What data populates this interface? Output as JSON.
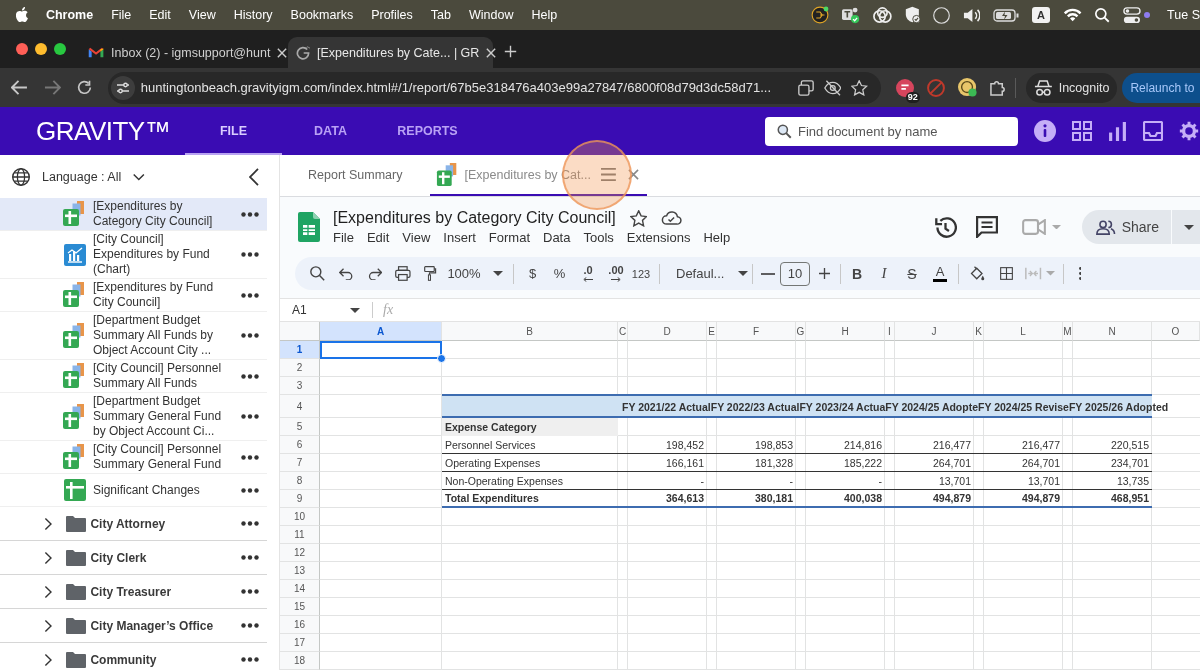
{
  "menubar": {
    "app": "Chrome",
    "items": [
      "File",
      "Edit",
      "View",
      "History",
      "Bookmarks",
      "Profiles",
      "Tab",
      "Window",
      "Help"
    ],
    "input_source": "A",
    "clock": "Tue S"
  },
  "browser": {
    "tabs": [
      {
        "kind": "mail",
        "title": "Inbox (2) - igmsupport@hunt",
        "selected": false
      },
      {
        "kind": "site",
        "title": "[Expenditures by Cate... | GR",
        "selected": true
      }
    ],
    "url": "huntingtonbeach.gravityigm.com/index.html#/1/report/67b5e318476a403e99a27847/6800f08d79d3dc58d71...",
    "extension_badge": "92",
    "profile": "Incognito",
    "relaunch": "Relaunch to"
  },
  "app_header": {
    "logo": "GRAVITY™",
    "tabs": [
      {
        "label": "FILE",
        "selected": true
      },
      {
        "label": "DATA",
        "selected": false
      },
      {
        "label": "REPORTS",
        "selected": false
      }
    ],
    "search": {
      "placeholder": "Find document by name"
    }
  },
  "sidebar": {
    "language": "Language : All",
    "items": [
      {
        "kind": "stack",
        "label": "[Expenditures by Category City Council]",
        "selected": true
      },
      {
        "kind": "chart",
        "label": "[City Council] Expenditures by Fund (Chart)",
        "selected": false
      },
      {
        "kind": "stack",
        "label": "[Expenditures by Fund City Council]",
        "selected": false
      },
      {
        "kind": "stack",
        "label": "[Department Budget Summary All Funds by Object Account City ...",
        "selected": false
      },
      {
        "kind": "stack",
        "label": "[City Council] Personnel Summary All Funds",
        "selected": false
      },
      {
        "kind": "stack",
        "label": "[Department Budget Summary General Fund by Object Account Ci...",
        "selected": false
      },
      {
        "kind": "stack",
        "label": "[City Council] Personnel Summary General Fund",
        "selected": false
      },
      {
        "kind": "sheet",
        "label": "Significant Changes",
        "selected": false
      },
      {
        "kind": "folder",
        "label": "City Attorney",
        "expanded": false,
        "selected": false
      },
      {
        "kind": "folder",
        "label": "City Clerk",
        "expanded": false,
        "selected": false
      },
      {
        "kind": "folder",
        "label": "City Treasurer",
        "expanded": false,
        "selected": false
      },
      {
        "kind": "folder",
        "label": "City Manager’s Office",
        "expanded": false,
        "selected": false
      },
      {
        "kind": "folder",
        "label": "Community",
        "expanded": false,
        "selected": false
      }
    ]
  },
  "report_tabs": [
    {
      "kind": "summary",
      "label": "Report Summary",
      "selected": false
    },
    {
      "kind": "sheet",
      "label": "[Expenditures by Cat...",
      "selected": true
    }
  ],
  "sheet": {
    "title": "[Expenditures by Category City Council]",
    "menu": [
      "File",
      "Edit",
      "View",
      "Insert",
      "Format",
      "Data",
      "Tools",
      "Extensions",
      "Help"
    ],
    "share": "Share",
    "toolbar": {
      "zoom": "100%",
      "currency": "$",
      "percent": "%",
      "decrease_decimal": ".0",
      "increase_decimal": ".00",
      "number_format": "123",
      "font": "Defaul...",
      "font_size": "10",
      "bold": "B",
      "italic": "I",
      "strikethrough": "S",
      "text_color": "A"
    },
    "name_box": "A1",
    "formula_icon": "fx",
    "columns": [
      {
        "label": "A",
        "selected": true
      },
      {
        "label": "B",
        "selected": false
      },
      {
        "label": "C",
        "selected": false
      },
      {
        "label": "D",
        "selected": false
      },
      {
        "label": "E",
        "selected": false
      },
      {
        "label": "F",
        "selected": false
      },
      {
        "label": "G",
        "selected": false
      },
      {
        "label": "H",
        "selected": false
      },
      {
        "label": "I",
        "selected": false
      },
      {
        "label": "J",
        "selected": false
      },
      {
        "label": "K",
        "selected": false
      },
      {
        "label": "L",
        "selected": false
      },
      {
        "label": "M",
        "selected": false
      },
      {
        "label": "N",
        "selected": false
      },
      {
        "label": "O",
        "selected": false
      }
    ],
    "rows": [
      {
        "label": "1",
        "selected": true
      },
      {
        "label": "2",
        "selected": false
      },
      {
        "label": "3",
        "selected": false
      },
      {
        "label": "4",
        "selected": false
      },
      {
        "label": "5",
        "selected": false
      },
      {
        "label": "6",
        "selected": false
      },
      {
        "label": "7",
        "selected": false
      },
      {
        "label": "8",
        "selected": false
      },
      {
        "label": "9",
        "selected": false
      },
      {
        "label": "10",
        "selected": false
      },
      {
        "label": "11",
        "selected": false
      },
      {
        "label": "12",
        "selected": false
      },
      {
        "label": "13",
        "selected": false
      },
      {
        "label": "14",
        "selected": false
      },
      {
        "label": "15",
        "selected": false
      },
      {
        "label": "16",
        "selected": false
      },
      {
        "label": "17",
        "selected": false
      },
      {
        "label": "18",
        "selected": false
      }
    ],
    "table": {
      "headings": [
        "FY 2021/22 Actual",
        "FY 2022/23 Actual",
        "FY 2023/24 Actua",
        "FY 2024/25 Adopte",
        "FY 2024/25 Revise",
        "FY 2025/26 Adopted"
      ],
      "category_label": "Expense Category",
      "rows": [
        {
          "label": "Personnel Services",
          "total": false,
          "values": [
            "198,452",
            "198,853",
            "214,816",
            "216,477",
            "216,477",
            "220,515"
          ]
        },
        {
          "label": "Operating Expenses",
          "total": false,
          "values": [
            "166,161",
            "181,328",
            "185,222",
            "264,701",
            "264,701",
            "234,701"
          ]
        },
        {
          "label": "Non-Operating Expenses",
          "total": false,
          "values": [
            "-",
            "-",
            "-",
            "13,701",
            "13,701",
            "13,735"
          ]
        },
        {
          "label": "Total Expenditures",
          "total": true,
          "values": [
            "364,613",
            "380,181",
            "400,038",
            "494,879",
            "494,879",
            "468,951"
          ]
        }
      ]
    }
  }
}
